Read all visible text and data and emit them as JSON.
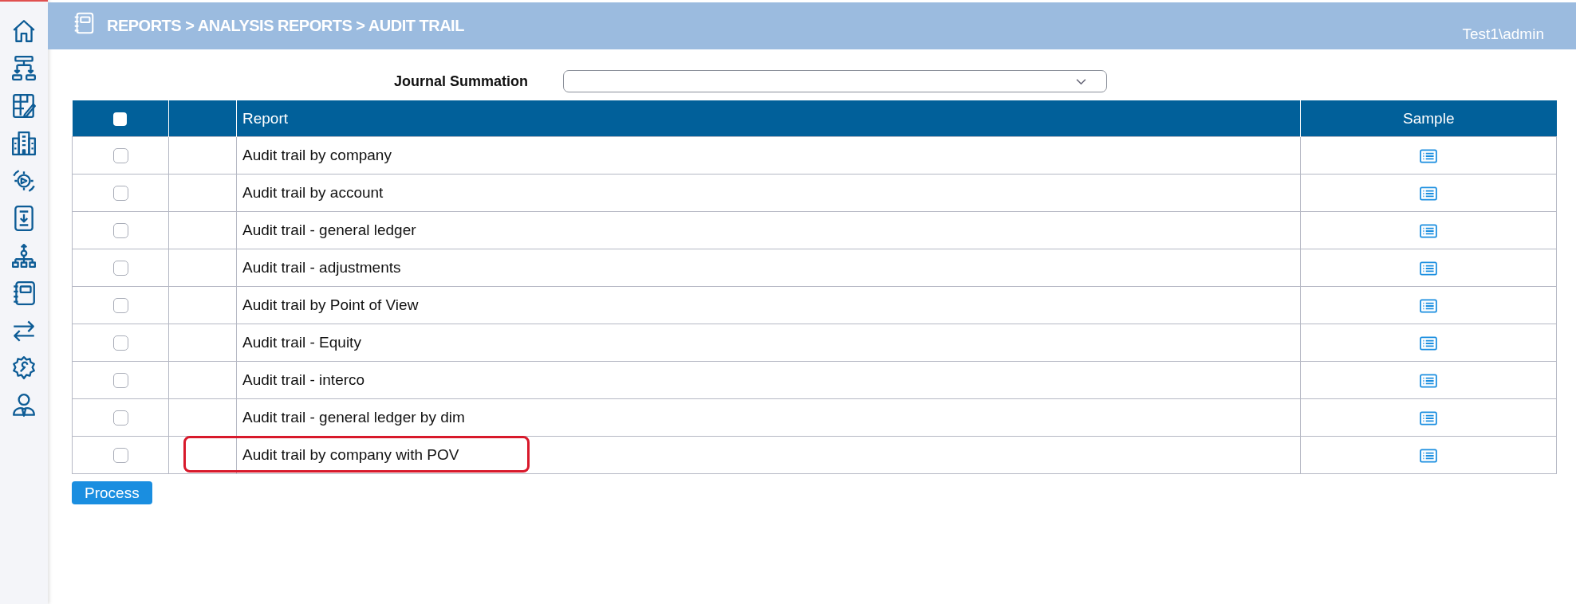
{
  "header": {
    "breadcrumb": "REPORTS > ANALYSIS REPORTS > AUDIT TRAIL",
    "user": "Test1\\admin"
  },
  "filter": {
    "label": "Journal Summation"
  },
  "table": {
    "select_all_checked": false,
    "columns": [
      "Report",
      "Sample"
    ],
    "rows": [
      {
        "report": "Audit trail by company",
        "checked": false,
        "highlighted": false
      },
      {
        "report": "Audit trail by account",
        "checked": false,
        "highlighted": false
      },
      {
        "report": "Audit trail - general ledger",
        "checked": false,
        "highlighted": false
      },
      {
        "report": "Audit trail - adjustments",
        "checked": false,
        "highlighted": false
      },
      {
        "report": "Audit trail by Point of View",
        "checked": false,
        "highlighted": false
      },
      {
        "report": "Audit trail - Equity",
        "checked": false,
        "highlighted": false
      },
      {
        "report": "Audit trail - interco",
        "checked": false,
        "highlighted": false
      },
      {
        "report": "Audit trail - general ledger by dim",
        "checked": false,
        "highlighted": false
      },
      {
        "report": "Audit trail by company with POV",
        "checked": false,
        "highlighted": true
      }
    ]
  },
  "buttons": [
    "Process"
  ]
}
